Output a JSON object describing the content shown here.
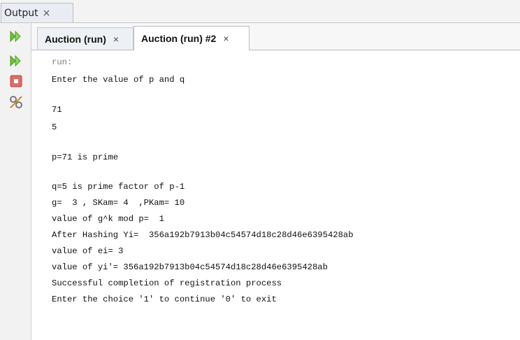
{
  "output_panel": {
    "tab_label": "Output",
    "close_symbol": "×"
  },
  "toolbar": {
    "icons": [
      "rerun-icon",
      "rerun-with-options-icon",
      "stop-icon",
      "settings-icon"
    ]
  },
  "run_tabs": [
    {
      "label": "Auction (run)",
      "close_symbol": "×",
      "active": false
    },
    {
      "label": "Auction (run) #2",
      "close_symbol": "×",
      "active": true
    }
  ],
  "console": {
    "lines": [
      "run:",
      "Enter the value of p and q",
      "",
      "71",
      "5",
      "",
      "p=71 is prime",
      "",
      "q=5 is prime factor of p-1",
      "g=  3 , SKam= 4  ,PKam= 10",
      "value of g^k mod p=  1",
      "After Hashing Yi=  356a192b7913b04c54574d18c28d46e6395428ab",
      "value of ei= 3",
      "value of yi'= 356a192b7913b04c54574d18c28d46e6395428ab",
      "Successful completion of registration process",
      "Enter the choice '1' to continue '0' to exit"
    ]
  },
  "colors": {
    "run_green": "#6fbf3a",
    "stop_red": "#d9534f",
    "muted_text": "#7d7d7d"
  }
}
